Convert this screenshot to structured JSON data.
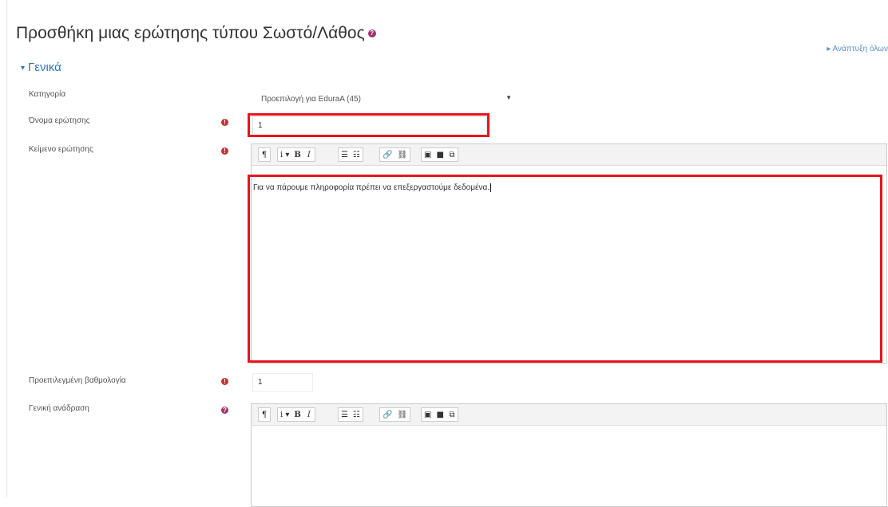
{
  "page": {
    "title": "Προσθήκη μιας ερώτησης τύπου Σωστό/Λάθος",
    "expand_all": "▸ Ανάπτυξη όλων"
  },
  "section": {
    "title": "Γενικά"
  },
  "fields": {
    "category": {
      "label": "Κατηγορία",
      "value": "Προεπιλογή για EduraA (45)"
    },
    "question_name": {
      "label": "Όνομα ερώτησης",
      "value": "1"
    },
    "question_text": {
      "label": "Κείμενο ερώτησης",
      "value": "Για να πάρουμε πληροφορία πρέπει να επεξεργαστούμε δεδομένα."
    },
    "default_mark": {
      "label": "Προεπιλεγμένη βαθμολογία",
      "value": "1"
    },
    "general_feedback": {
      "label": "Γενική ανάδραση",
      "value": ""
    }
  },
  "toolbar": {
    "paragraph": "¶",
    "info": "i ▾",
    "bold": "B",
    "italic": "I",
    "ul": "☰",
    "ol": "☷",
    "link": "🔗",
    "unlink": "⛓",
    "image": "▣",
    "media": "■",
    "manage": "⧉"
  },
  "colors": {
    "accent": "#2a74c2",
    "required": "#c9302c",
    "highlight": "#e8141d",
    "help": "#a2326e"
  }
}
